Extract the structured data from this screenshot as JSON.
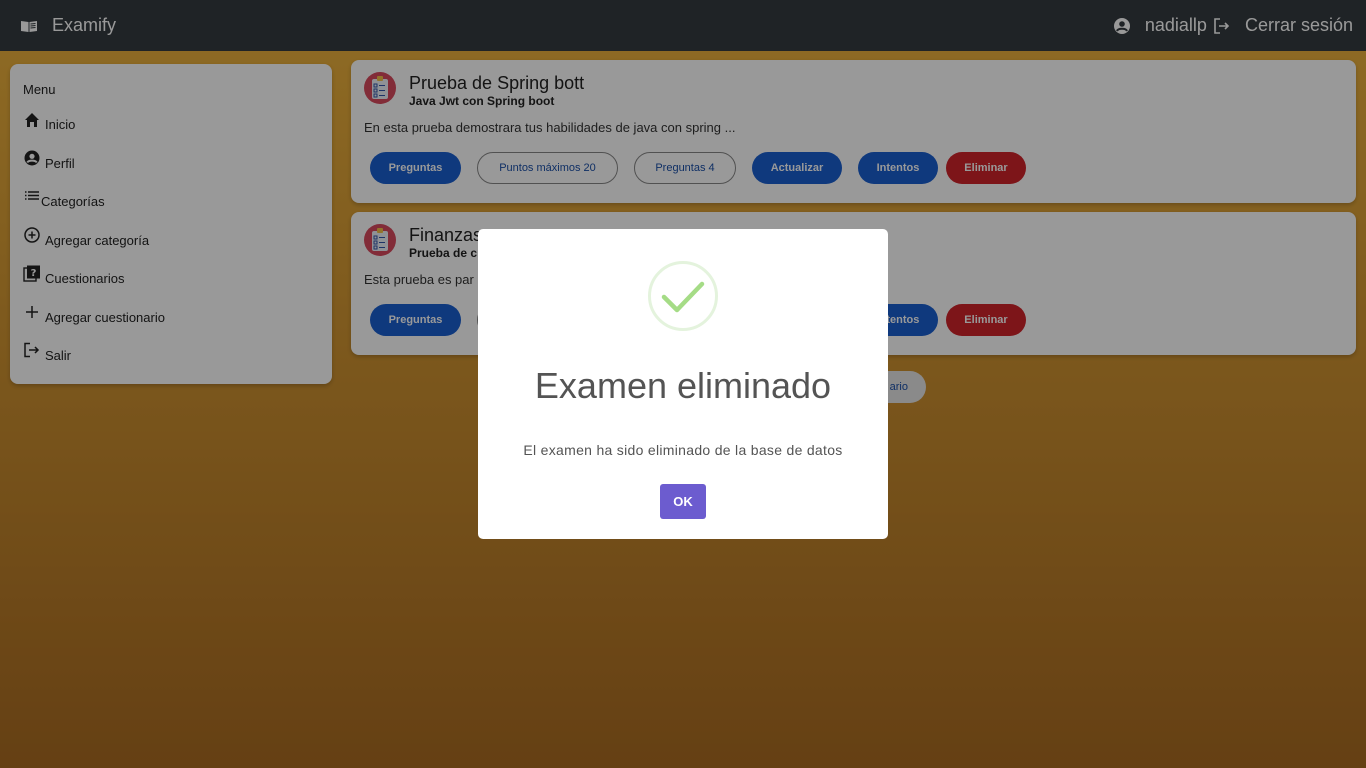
{
  "header": {
    "brand": "Examify",
    "username": "nadiallp",
    "logout_label": "Cerrar sesión"
  },
  "sidebar": {
    "title": "Menu",
    "items": [
      {
        "label": "Inicio",
        "icon": "home-icon"
      },
      {
        "label": "Perfil",
        "icon": "account-circle-icon"
      },
      {
        "label": "Categorías",
        "icon": "list-icon"
      },
      {
        "label": "Agregar categoría",
        "icon": "add-circle-icon"
      },
      {
        "label": "Cuestionarios",
        "icon": "quiz-icon"
      },
      {
        "label": "Agregar cuestionario",
        "icon": "plus-icon"
      },
      {
        "label": "Salir",
        "icon": "logout-icon"
      }
    ]
  },
  "exams": [
    {
      "title": "Prueba de Spring bott",
      "subtitle": "Java Jwt con Spring boot",
      "description": "En esta prueba demostrara tus habilidades de java con spring ...",
      "buttons": {
        "questions": "Preguntas",
        "max_points": "Puntos máximos 20",
        "question_count": "Preguntas 4",
        "update": "Actualizar",
        "attempts": "Intentos",
        "delete": "Eliminar"
      }
    },
    {
      "title": "Finanzas",
      "subtitle": "Prueba de c",
      "description": "Esta prueba es par",
      "buttons": {
        "questions": "Preguntas",
        "attempts": "Intentos",
        "delete": "Eliminar"
      }
    }
  ],
  "add_exam_button_partial": "ario",
  "modal": {
    "icon": "success-check-icon",
    "title": "Examen eliminado",
    "text": "El examen ha sido eliminado de la base de datos",
    "confirm_label": "OK"
  },
  "colors": {
    "topbar": "#353b40",
    "primary_button": "#1a5fd1",
    "danger_button": "#d0232b",
    "confirm_button": "#6c5ccf",
    "success": "#a5dc86"
  }
}
